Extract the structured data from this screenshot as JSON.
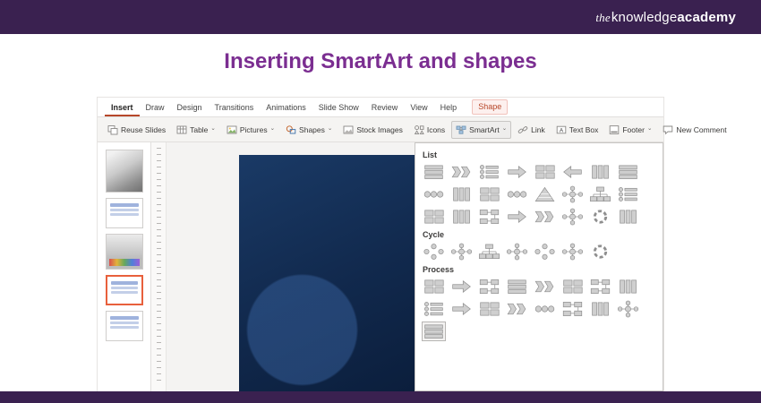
{
  "brand": {
    "the": "the",
    "knowledge": "knowledge",
    "academy": "academy"
  },
  "page": {
    "title": "Inserting SmartArt and shapes"
  },
  "colors": {
    "banner_purple": "#3a2150",
    "title_purple": "#7b2e91",
    "tab_accent_red": "#b7472a",
    "slide_navy": "#11294d",
    "selection_orange": "#e8603c"
  },
  "ribbon": {
    "caret": "⌄",
    "tabs": [
      {
        "label": "Insert",
        "active": true
      },
      {
        "label": "Draw"
      },
      {
        "label": "Design"
      },
      {
        "label": "Transitions"
      },
      {
        "label": "Animations"
      },
      {
        "label": "Slide Show"
      },
      {
        "label": "Review"
      },
      {
        "label": "View"
      },
      {
        "label": "Help"
      },
      {
        "label": "Shape",
        "contextual": true
      }
    ],
    "toolbar": [
      {
        "label": "Reuse Slides",
        "icon": "reuse-slides"
      },
      {
        "label": "Table",
        "icon": "table",
        "dropdown": true
      },
      {
        "label": "Pictures",
        "icon": "pictures",
        "dropdown": true
      },
      {
        "label": "Shapes",
        "icon": "shapes",
        "dropdown": true
      },
      {
        "label": "Stock Images",
        "icon": "stock-images"
      },
      {
        "label": "Icons",
        "icon": "icons"
      },
      {
        "label": "SmartArt",
        "icon": "smartart",
        "dropdown": true,
        "highlighted": true
      },
      {
        "label": "Link",
        "icon": "link"
      },
      {
        "label": "Text Box",
        "icon": "text-box"
      },
      {
        "label": "Footer",
        "icon": "footer",
        "dropdown": true
      },
      {
        "label": "New Comment",
        "icon": "new-comment"
      }
    ]
  },
  "thumbnails": [
    {
      "type": "photo"
    },
    {
      "type": "text"
    },
    {
      "type": "photo2"
    },
    {
      "type": "text",
      "selected": true
    },
    {
      "type": "text"
    }
  ],
  "smartart": {
    "sections": [
      {
        "name": "List",
        "items": [
          {
            "icon": "rows"
          },
          {
            "icon": "chevrons"
          },
          {
            "icon": "listpic"
          },
          {
            "icon": "arrow"
          },
          {
            "icon": "grid"
          },
          {
            "icon": "arrowl"
          },
          {
            "icon": "cols"
          },
          {
            "icon": "rows"
          },
          {
            "icon": "circlerow"
          },
          {
            "icon": "cols"
          },
          {
            "icon": "grid"
          },
          {
            "icon": "circlerow"
          },
          {
            "icon": "pyramid"
          },
          {
            "icon": "hub"
          },
          {
            "icon": "tree"
          },
          {
            "icon": "listpic"
          },
          {
            "icon": "grid"
          },
          {
            "icon": "cols"
          },
          {
            "icon": "bend"
          },
          {
            "icon": "arrow"
          },
          {
            "icon": "chevrons"
          },
          {
            "icon": "hub"
          },
          {
            "icon": "ring"
          },
          {
            "icon": "cols"
          }
        ]
      },
      {
        "name": "Cycle",
        "items": [
          {
            "icon": "cycle"
          },
          {
            "icon": "hub"
          },
          {
            "icon": "tree"
          },
          {
            "icon": "hub"
          },
          {
            "icon": "cycle"
          },
          {
            "icon": "hub"
          },
          {
            "icon": "ring"
          }
        ]
      },
      {
        "name": "Process",
        "items": [
          {
            "icon": "grid"
          },
          {
            "icon": "arrow"
          },
          {
            "icon": "bend"
          },
          {
            "icon": "rows"
          },
          {
            "icon": "chevrons"
          },
          {
            "icon": "grid"
          },
          {
            "icon": "bend"
          },
          {
            "icon": "cols"
          },
          {
            "icon": "listpic"
          },
          {
            "icon": "arrow"
          },
          {
            "icon": "grid"
          },
          {
            "icon": "chevrons"
          },
          {
            "icon": "circlerow"
          },
          {
            "icon": "bend"
          },
          {
            "icon": "cols"
          },
          {
            "icon": "hub"
          },
          {
            "icon": "rows",
            "selected": true
          }
        ]
      }
    ]
  }
}
